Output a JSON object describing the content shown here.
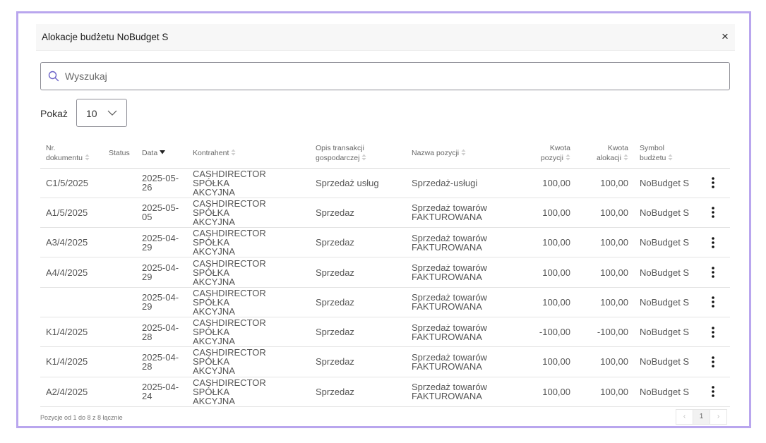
{
  "modal": {
    "title": "Alokacje budżetu NoBudget S",
    "close_icon": "×"
  },
  "search": {
    "placeholder": "Wyszukaj"
  },
  "page_size": {
    "label": "Pokaż",
    "value": "10"
  },
  "table": {
    "columns": [
      {
        "l1": "Nr.",
        "l2": "dokumentu",
        "sort": "both"
      },
      {
        "l1": "Status",
        "l2": "",
        "sort": "none"
      },
      {
        "l1": "Data",
        "l2": "",
        "sort": "desc"
      },
      {
        "l1": "Kontrahent",
        "l2": "",
        "sort": "both"
      },
      {
        "l1": "Opis transakcji",
        "l2": "gospodarczej",
        "sort": "both"
      },
      {
        "l1": "Nazwa pozycji",
        "l2": "",
        "sort": "both"
      },
      {
        "l1": "Kwota",
        "l2": "pozycji",
        "sort": "both"
      },
      {
        "l1": "Kwota",
        "l2": "alokacji",
        "sort": "both"
      },
      {
        "l1": "Symbol",
        "l2": "budżetu",
        "sort": "both"
      }
    ],
    "rows": [
      {
        "doc": "C1/5/2025",
        "status": "",
        "date_1": "2025-05-",
        "date_2": "26",
        "contractor_1": "CASHDIRECTOR SPÓŁKA",
        "contractor_2": "AKCYJNA",
        "desc": "Sprzedaż usług",
        "item_1": "Sprzedaż-usługi",
        "item_2": "",
        "amount": "100,00",
        "allocation": "100,00",
        "budget": "NoBudget S"
      },
      {
        "doc": "A1/5/2025",
        "status": "",
        "date_1": "2025-05-",
        "date_2": "05",
        "contractor_1": "CASHDIRECTOR SPÓŁKA",
        "contractor_2": "AKCYJNA",
        "desc": "Sprzedaz",
        "item_1": "Sprzedaż towarów",
        "item_2": "FAKTUROWANA",
        "amount": "100,00",
        "allocation": "100,00",
        "budget": "NoBudget S"
      },
      {
        "doc": "A3/4/2025",
        "status": "",
        "date_1": "2025-04-",
        "date_2": "29",
        "contractor_1": "CASHDIRECTOR SPÓŁKA",
        "contractor_2": "AKCYJNA",
        "desc": "Sprzedaz",
        "item_1": "Sprzedaż towarów",
        "item_2": "FAKTUROWANA",
        "amount": "100,00",
        "allocation": "100,00",
        "budget": "NoBudget S"
      },
      {
        "doc": "A4/4/2025",
        "status": "",
        "date_1": "2025-04-",
        "date_2": "29",
        "contractor_1": "CASHDIRECTOR SPÓŁKA",
        "contractor_2": "AKCYJNA",
        "desc": "Sprzedaz",
        "item_1": "Sprzedaż towarów",
        "item_2": "FAKTUROWANA",
        "amount": "100,00",
        "allocation": "100,00",
        "budget": "NoBudget S"
      },
      {
        "doc": "",
        "status": "",
        "date_1": "2025-04-",
        "date_2": "29",
        "contractor_1": "CASHDIRECTOR SPÓŁKA",
        "contractor_2": "AKCYJNA",
        "desc": "Sprzedaz",
        "item_1": "Sprzedaż towarów",
        "item_2": "FAKTUROWANA",
        "amount": "100,00",
        "allocation": "100,00",
        "budget": "NoBudget S"
      },
      {
        "doc": "K1/4/2025",
        "status": "",
        "date_1": "2025-04-",
        "date_2": "28",
        "contractor_1": "CASHDIRECTOR SPÓŁKA",
        "contractor_2": "AKCYJNA",
        "desc": "Sprzedaz",
        "item_1": "Sprzedaż towarów",
        "item_2": "FAKTUROWANA",
        "amount": "-100,00",
        "allocation": "-100,00",
        "budget": "NoBudget S"
      },
      {
        "doc": "K1/4/2025",
        "status": "",
        "date_1": "2025-04-",
        "date_2": "28",
        "contractor_1": "CASHDIRECTOR SPÓŁKA",
        "contractor_2": "AKCYJNA",
        "desc": "Sprzedaz",
        "item_1": "Sprzedaż towarów",
        "item_2": "FAKTUROWANA",
        "amount": "100,00",
        "allocation": "100,00",
        "budget": "NoBudget S"
      },
      {
        "doc": "A2/4/2025",
        "status": "",
        "date_1": "2025-04-",
        "date_2": "24",
        "contractor_1": "CASHDIRECTOR SPÓŁKA",
        "contractor_2": "AKCYJNA",
        "desc": "Sprzedaz",
        "item_1": "Sprzedaż towarów",
        "item_2": "FAKTUROWANA",
        "amount": "100,00",
        "allocation": "100,00",
        "budget": "NoBudget S"
      }
    ]
  },
  "footer": {
    "info": "Pozycje od 1 do 8 z 8 łącznie",
    "prev_icon": "‹",
    "current_page": "1",
    "next_icon": "›"
  },
  "icons": {
    "search": "search-icon",
    "chevron": "chevron-down-icon",
    "sort": "sort-icon",
    "more": "more-vertical-icon"
  },
  "colors": {
    "frame": "#b9a6ee",
    "header_bg": "#f7f7f7"
  }
}
